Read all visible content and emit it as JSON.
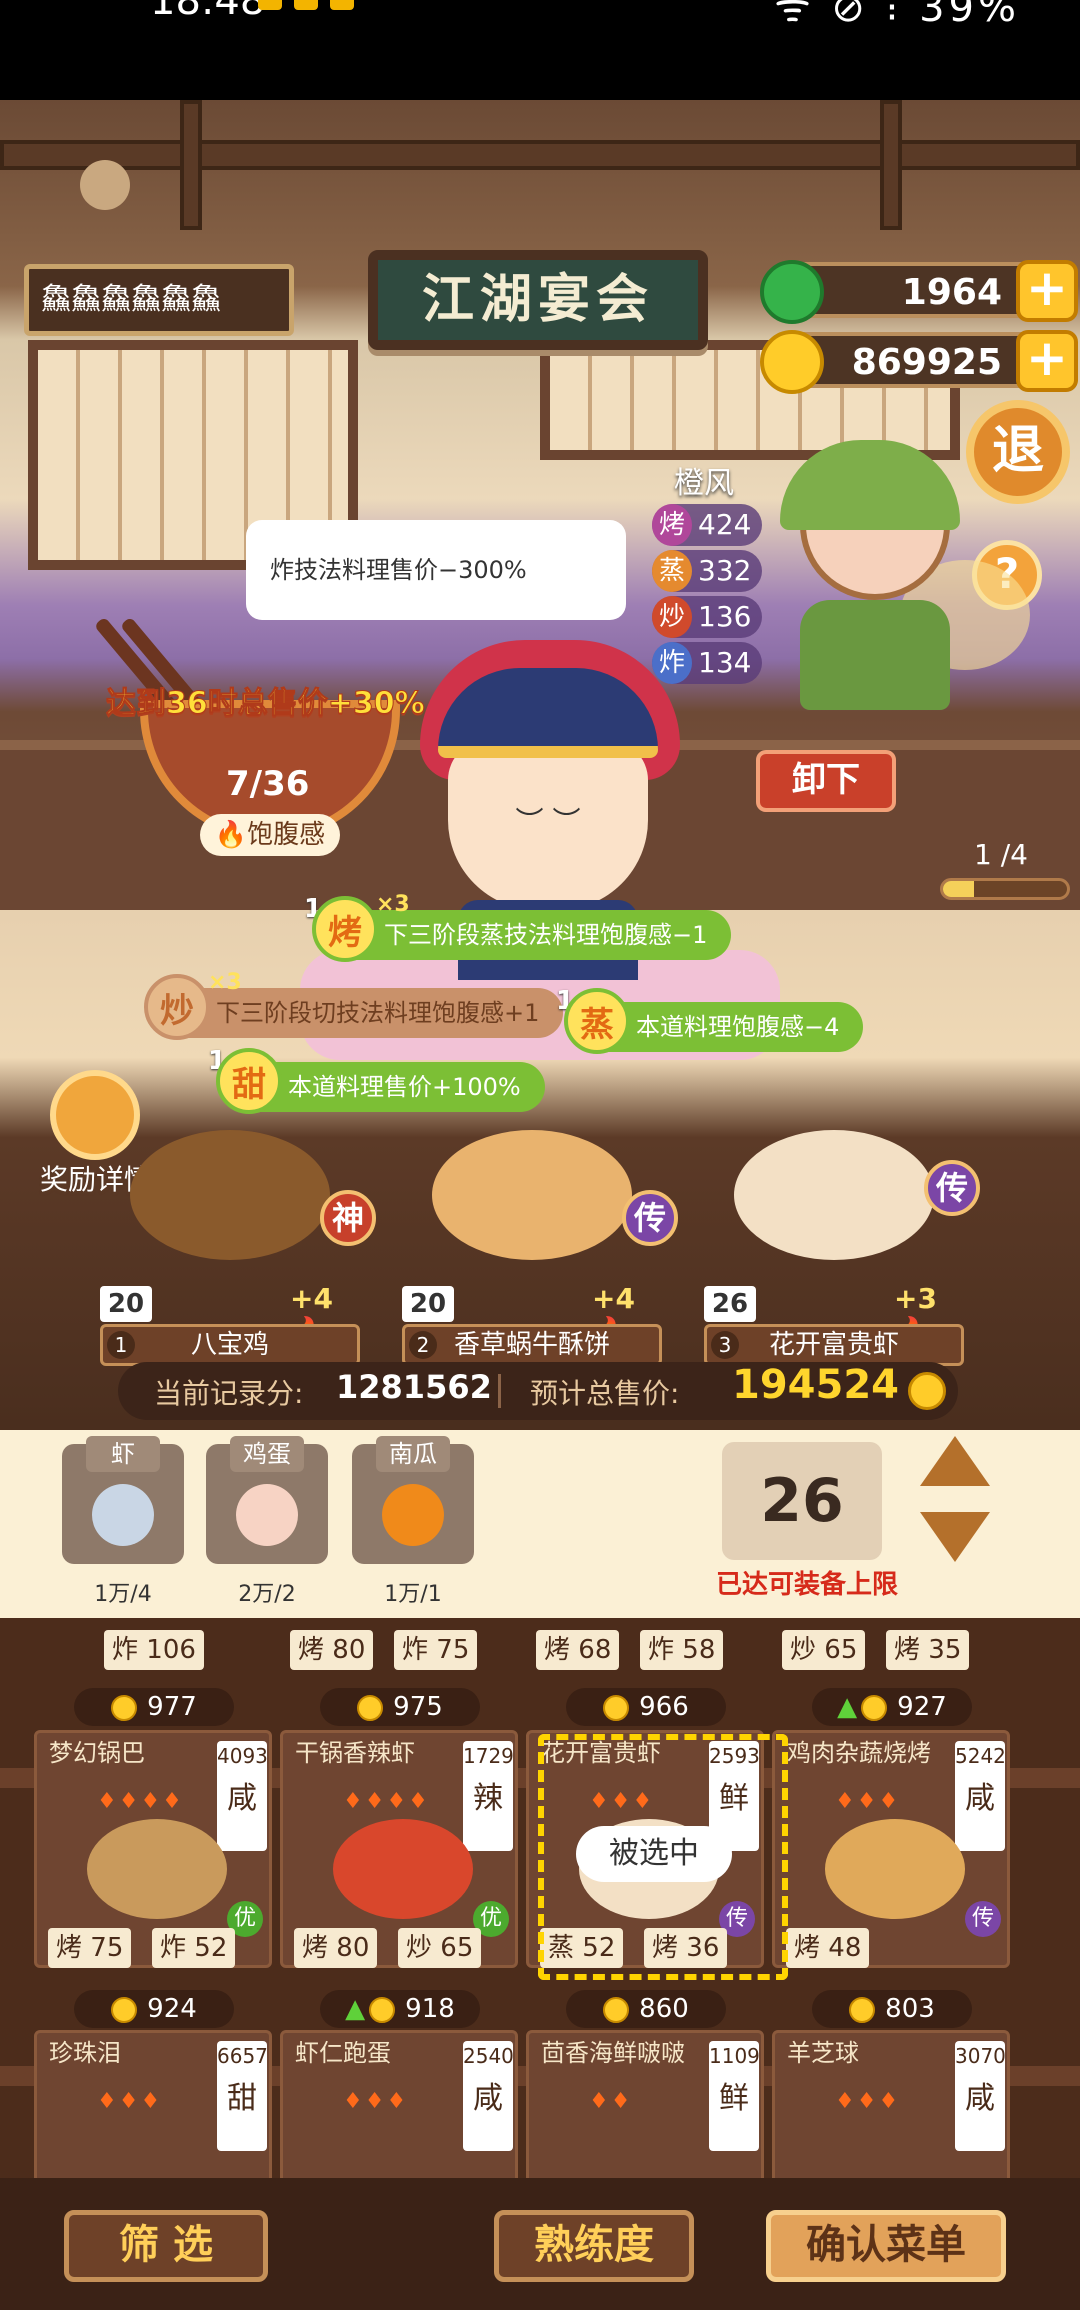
{
  "status_bar": {
    "time": "18:48",
    "right": "ᯤ ⊘ ⁝ 39%"
  },
  "header": {
    "player_name": "鱻鱻鱻鱻鱻鱻",
    "sign": "江湖宴会",
    "jade": "1964",
    "coins": "869925",
    "exit": "退",
    "help": "?"
  },
  "npc": {
    "name": "橙风",
    "stats": [
      {
        "k": "烤",
        "v": "424",
        "color": "#b0479a"
      },
      {
        "k": "蒸",
        "v": "332",
        "color": "#e58a2f"
      },
      {
        "k": "炒",
        "v": "136",
        "color": "#d04a2c"
      },
      {
        "k": "炸",
        "v": "134",
        "color": "#4b6fc9"
      }
    ]
  },
  "bubble": "炸技法料理售价−300%",
  "bowl": {
    "goal": "达到36时总售价+30%",
    "count": "7/36",
    "label": "饱腹感"
  },
  "unload": "卸下",
  "progress": {
    "text": "1 /4",
    "fraction": 0.25
  },
  "tags": [
    {
      "lvl": "1",
      "icon": "烤",
      "mul": "×3",
      "text": "下三阶段蒸技法料理饱腹感−1",
      "dim": false
    },
    {
      "lvl": "",
      "icon": "炒",
      "mul": "×3",
      "text": "下三阶段切技法料理饱腹感+1",
      "dim": true
    },
    {
      "lvl": "1",
      "icon": "蒸",
      "mul": "",
      "text": "本道料理饱腹感−4",
      "dim": false
    },
    {
      "lvl": "1",
      "icon": "甜",
      "mul": "",
      "text": "本道料理售价+100%",
      "dim": false
    }
  ],
  "reward": "奖励详情",
  "showcase": [
    {
      "n": "1",
      "name": "八宝鸡",
      "count": "20",
      "bonus": "+4",
      "rank": "神",
      "plate": "#8a5a2c"
    },
    {
      "n": "2",
      "name": "香草蜗牛酥饼",
      "count": "20",
      "bonus": "+4",
      "rank": "传",
      "plate": "#e9b36e"
    },
    {
      "n": "3",
      "name": "花开富贵虾",
      "count": "26",
      "bonus": "+3",
      "rank": "传",
      "plate": "#f3e0c5"
    }
  ],
  "score": {
    "record_label": "当前记录分:",
    "record": "1281562",
    "total_label": "预计总售价:",
    "total": "194524"
  },
  "ingredients": [
    {
      "name": "虾",
      "qty": "1万/4",
      "color": "#c9d6e5"
    },
    {
      "name": "鸡蛋",
      "qty": "2万/2",
      "color": "#f7d3c4"
    },
    {
      "name": "南瓜",
      "qty": "1万/1",
      "color": "#f08a1a"
    }
  ],
  "capacity": {
    "value": "26",
    "note": "已达可装备上限"
  },
  "grid_top": [
    {
      "skills": [
        {
          "k": "炸",
          "v": "106"
        }
      ],
      "price": "977",
      "up": false
    },
    {
      "skills": [
        {
          "k": "烤",
          "v": "80"
        },
        {
          "k": "炸",
          "v": "75"
        }
      ],
      "price": "975",
      "up": false
    },
    {
      "skills": [
        {
          "k": "烤",
          "v": "68"
        },
        {
          "k": "炸",
          "v": "58"
        }
      ],
      "price": "966",
      "up": false
    },
    {
      "skills": [
        {
          "k": "炒",
          "v": "65"
        },
        {
          "k": "烤",
          "v": "35"
        }
      ],
      "price": "927",
      "up": true
    }
  ],
  "grid_mid": [
    {
      "title": "梦幻锅巴",
      "num": "4093",
      "taste": "咸",
      "hearts": "♦♦♦♦",
      "badge": "优",
      "skills": [
        {
          "k": "烤",
          "v": "75"
        },
        {
          "k": "炸",
          "v": "52"
        }
      ],
      "price": "924",
      "up": false,
      "food": "#c99a5c"
    },
    {
      "title": "干锅香辣虾",
      "num": "1729",
      "taste": "辣",
      "hearts": "♦♦♦♦",
      "badge": "优",
      "skills": [
        {
          "k": "烤",
          "v": "80"
        },
        {
          "k": "炒",
          "v": "65"
        }
      ],
      "price": "918",
      "up": true,
      "food": "#d9472c"
    },
    {
      "title": "花开富贵虾",
      "num": "2593",
      "taste": "鲜",
      "hearts": "♦♦♦",
      "badge": "传",
      "skills": [
        {
          "k": "蒸",
          "v": "52"
        },
        {
          "k": "烤",
          "v": "36"
        }
      ],
      "price": "860",
      "up": false,
      "food": "#f3e0c5"
    },
    {
      "title": "鸡肉杂蔬烧烤",
      "num": "5242",
      "taste": "咸",
      "hearts": "♦♦♦",
      "badge": "传",
      "skills": [
        {
          "k": "烤",
          "v": "48"
        }
      ],
      "price": "803",
      "up": false,
      "food": "#e0a95a"
    }
  ],
  "grid_bottom": [
    {
      "title": "珍珠泪",
      "num": "6657",
      "taste": "甜",
      "hearts": "♦♦♦"
    },
    {
      "title": "虾仁跑蛋",
      "num": "2540",
      "taste": "咸",
      "hearts": "♦♦♦"
    },
    {
      "title": "茴香海鲜啵啵",
      "num": "1109",
      "taste": "鲜",
      "hearts": "♦♦"
    },
    {
      "title": "羊芝球",
      "num": "3070",
      "taste": "咸",
      "hearts": "♦♦♦"
    }
  ],
  "selected_label": "被选中",
  "bottom_buttons": {
    "filter": "筛 选",
    "proficiency": "熟练度",
    "confirm": "确认菜单"
  }
}
